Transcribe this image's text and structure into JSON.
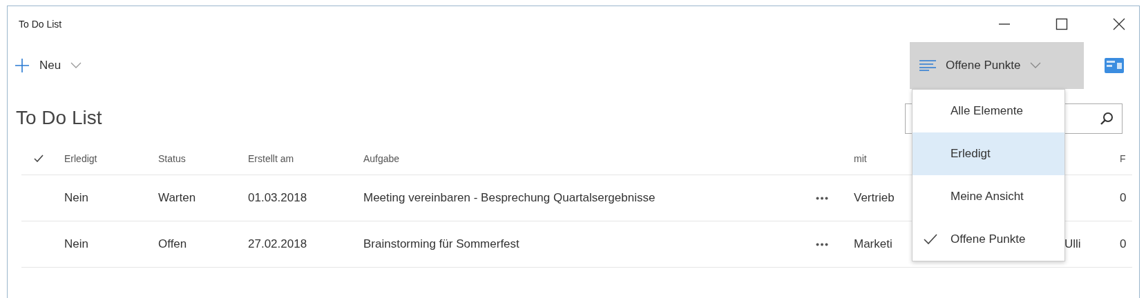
{
  "window": {
    "title": "To Do List"
  },
  "toolbar": {
    "new_button": {
      "label": "Neu"
    },
    "view_button": {
      "label": "Offene Punkte",
      "expanded": true
    }
  },
  "heading": "To Do List",
  "view_menu": [
    {
      "label": "Alle Elemente",
      "selected": false,
      "highlighted": false
    },
    {
      "label": "Erledigt",
      "selected": false,
      "highlighted": true
    },
    {
      "label": "Meine Ansicht",
      "selected": false,
      "highlighted": false
    },
    {
      "label": "Offene Punkte",
      "selected": true,
      "highlighted": false
    }
  ],
  "table": {
    "columns": [
      "Erledigt",
      "Status",
      "Erstellt am",
      "Aufgabe",
      "mit",
      "F"
    ],
    "rows": [
      {
        "erledigt": "Nein",
        "status": "Warten",
        "erstellt_am": "01.03.2018",
        "aufgabe": "Meeting vereinbaren - Besprechung Quartalsergebnisse",
        "mit": "Vertrieb",
        "f": "0"
      },
      {
        "erledigt": "Nein",
        "status": "Offen",
        "erstellt_am": "27.02.2018",
        "aufgabe": "Brainstorming für Sommerfest",
        "mit": "Marketi",
        "column_8": "Ulli",
        "f": "0"
      }
    ]
  }
}
